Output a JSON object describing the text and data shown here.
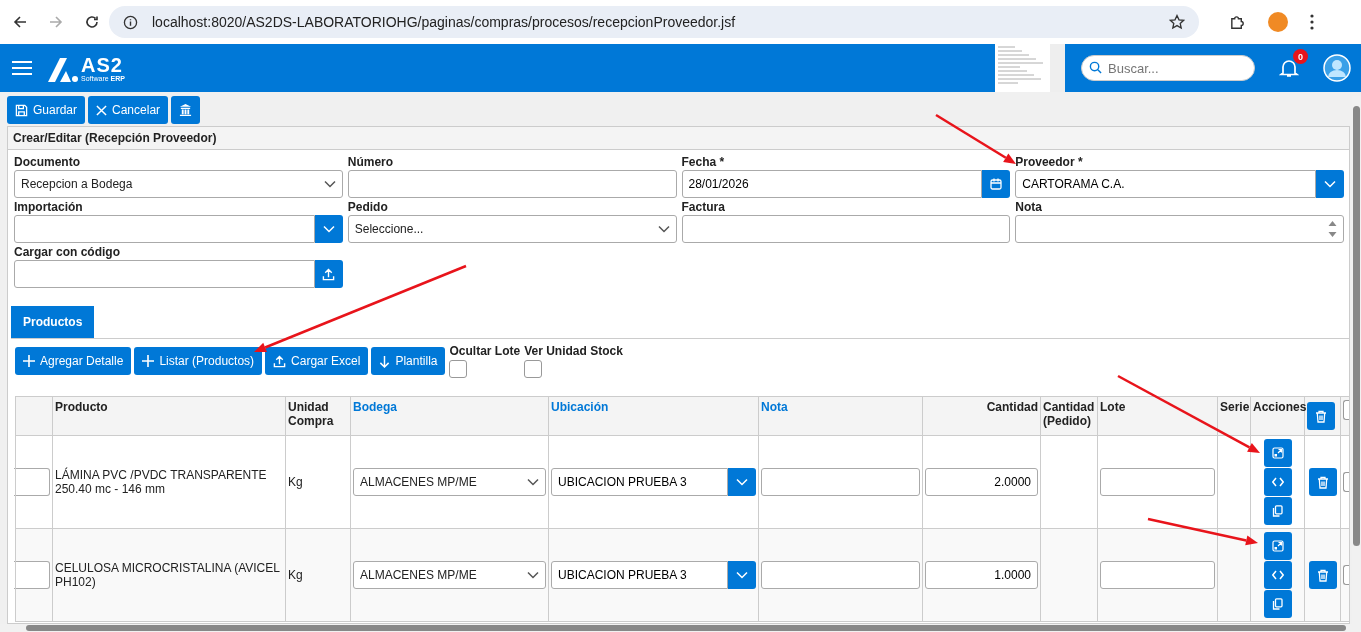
{
  "browser": {
    "url": "localhost:8020/AS2DS-LABORATORIOHG/paginas/compras/procesos/recepcionProveedor.jsf"
  },
  "header": {
    "logo": "AS2",
    "logo_sub": "Software",
    "logo_sub_bold": "ERP",
    "search": {
      "placeholder": "Buscar..."
    },
    "notifications": "0"
  },
  "toolbar": [
    {
      "label": "Guardar",
      "kind": "save"
    },
    {
      "label": "Cancelar",
      "kind": "close"
    },
    {
      "kind": "bank"
    }
  ],
  "panel": {
    "title": "Crear/Editar (Recepción Proveedor)"
  },
  "fields": [
    {
      "label": "Documento",
      "kind": "select",
      "value": "Recepcion a Bodega"
    },
    {
      "label": "Número",
      "kind": "text"
    },
    {
      "label": "Fecha *",
      "kind": "date",
      "value": "28/01/2026"
    },
    {
      "label": "Proveedor *",
      "kind": "combo",
      "value": "CARTORAMA C.A."
    },
    {
      "label": "Importación",
      "kind": "combo"
    },
    {
      "label": "Pedido",
      "kind": "select",
      "value": "Seleccione..."
    },
    {
      "label": "Factura",
      "kind": "text"
    },
    {
      "label": "Nota",
      "kind": "spinner"
    },
    {
      "label": "Cargar con código",
      "kind": "upload"
    }
  ],
  "tabs": [
    {
      "label": "Productos",
      "selected": true
    }
  ],
  "detail_buttons": [
    {
      "label": "Agregar Detalle",
      "kind": "plus"
    },
    {
      "label": "Listar (Productos)",
      "kind": "plus"
    },
    {
      "label": "Cargar Excel",
      "kind": "upload"
    },
    {
      "label": "Plantilla",
      "kind": "down"
    }
  ],
  "toggles": [
    {
      "label": "Ocultar Lote",
      "checked": false
    },
    {
      "label": "Ver Unidad Stock",
      "checked": false
    }
  ],
  "table": {
    "select_all_checked": false,
    "columns": [
      {
        "label": "Producto",
        "kind": "plain"
      },
      {
        "label": "Unidad Compra",
        "kind": "plain"
      },
      {
        "label": "Bodega",
        "kind": "link"
      },
      {
        "label": "Ubicación",
        "kind": "link"
      },
      {
        "label": "Nota",
        "kind": "link"
      },
      {
        "label": "Cantidad",
        "kind": "numeric"
      },
      {
        "label": "Cantidad (Pedido)",
        "kind": "plain"
      },
      {
        "label": "Lote",
        "kind": "plain"
      },
      {
        "label": "Serie",
        "kind": "plain"
      },
      {
        "label": "Acciones",
        "kind": "plain"
      }
    ],
    "rows": [
      {
        "producto": "LÁMINA PVC /PVDC TRANSPARENTE 250.40 mc - 146 mm",
        "unidad": "Kg",
        "bodega": "ALMACENES MP/ME",
        "ubicacion": "UBICACION PRUEBA 3",
        "cantidad": "2.0000",
        "checked": false
      },
      {
        "producto": "CELULOSA MICROCRISTALINA (AVICEL PH102)",
        "unidad": "Kg",
        "bodega": "ALMACENES MP/ME",
        "ubicacion": "UBICACION PRUEBA 3",
        "cantidad": "1.0000",
        "checked": false
      }
    ]
  },
  "overlay_arrows": [
    {
      "kind": "arrow"
    },
    {
      "kind": "arrow"
    },
    {
      "kind": "arrow"
    },
    {
      "kind": "arrow"
    }
  ]
}
